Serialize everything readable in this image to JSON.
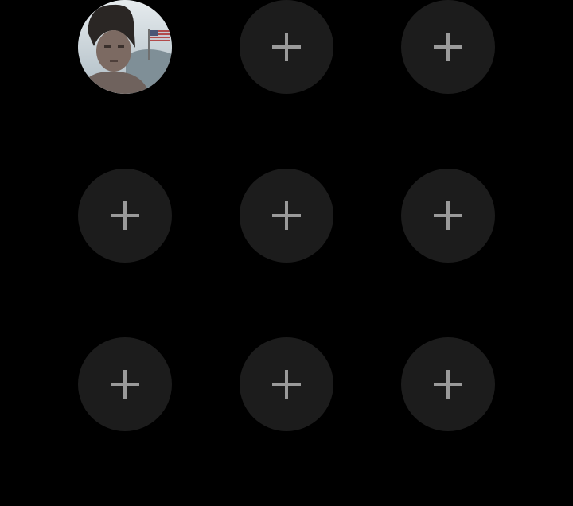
{
  "contacts": [
    {
      "type": "avatar",
      "icon": "user-photo-avatar"
    },
    {
      "type": "add",
      "icon": "plus-icon"
    },
    {
      "type": "add",
      "icon": "plus-icon"
    },
    {
      "type": "add",
      "icon": "plus-icon"
    },
    {
      "type": "add",
      "icon": "plus-icon"
    },
    {
      "type": "add",
      "icon": "plus-icon"
    },
    {
      "type": "add",
      "icon": "plus-icon"
    },
    {
      "type": "add",
      "icon": "plus-icon"
    },
    {
      "type": "add",
      "icon": "plus-icon"
    }
  ],
  "colors": {
    "background": "#000000",
    "slot": "#1c1c1c",
    "plus": "#9a9a9a"
  }
}
